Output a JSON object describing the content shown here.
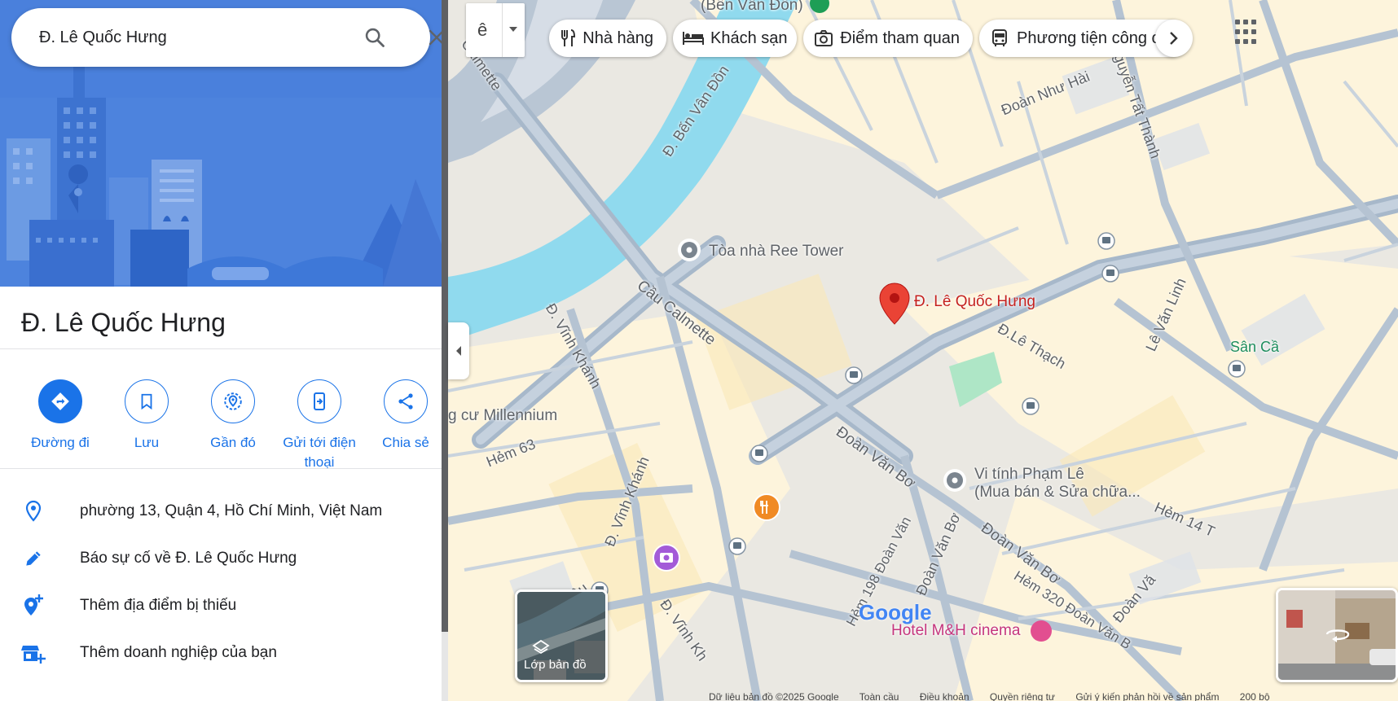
{
  "search": {
    "value": "Đ. Lê Quốc Hưng"
  },
  "place": {
    "title": "Đ. Lê Quốc Hưng"
  },
  "actions": [
    {
      "label": "Đường đi"
    },
    {
      "label": "Lưu"
    },
    {
      "label": "Gần đó"
    },
    {
      "label": "Gửi tới điện thoại"
    },
    {
      "label": "Chia sẻ"
    }
  ],
  "info": [
    {
      "text": "phường 13, Quận 4, Hồ Chí Minh, Việt Nam",
      "icon": "location-pin-icon"
    },
    {
      "text": "Báo sự cố về Đ. Lê Quốc Hưng",
      "icon": "pencil-icon"
    },
    {
      "text": "Thêm địa điểm bị thiếu",
      "icon": "add-place-icon"
    },
    {
      "text": "Thêm doanh nghiệp của bạn",
      "icon": "add-business-icon"
    }
  ],
  "toolbar": {
    "input_tool": "ê"
  },
  "chips": [
    {
      "label": "Nhà hàng",
      "icon": "fork-knife-icon"
    },
    {
      "label": "Khách sạn",
      "icon": "bed-icon"
    },
    {
      "label": "Điểm tham quan",
      "icon": "camera-icon"
    },
    {
      "label": "Phương tiện công c",
      "icon": "bus-icon"
    }
  ],
  "map": {
    "streets": {
      "ben_van_don_top": "(Bến Vân Đồn)",
      "calmette_top": "Calmette",
      "ben_van_don": "Đ. Bến Vân Đồn",
      "doan_nhu_hai": "Đoàn Như Hài",
      "nguyen_tat_thanh": "Nguyễn Tất Thành",
      "cau_calmette": "Cầu Calmette",
      "vinh_khanh_1": "Đ. Vĩnh Khánh",
      "vinh_khanh_2": "Đ. Vĩnh Khánh",
      "vinh_khanh_3": "Đ. Vĩnh Kh",
      "le_thach": "Đ.Lê Thạch",
      "le_van_linh": "Lê Văn Linh",
      "doan_van_bo_1": "Đoàn Văn Bơ",
      "doan_van_bo_2": "Đoàn Văn Bơ",
      "doan_van_bo_3": "Đoàn Văn Bơ",
      "doan_van_bo_4": "Đoàn Vă",
      "hem_63": "Hẻm 63",
      "hem_14": "Hẻm 14 T",
      "hem_198": "Hẻm 198 Đoàn Văn",
      "hem_320": "Hẻm 320 Đoàn Văn B",
      "hieu": "iệu",
      "san_ca": "Sân Cầ"
    },
    "pois": {
      "ree_tower": "Tòa nhà Ree Tower",
      "millennium": "g cư Millennium",
      "vi_tinh_1": "Vi tính Phạm Lê",
      "vi_tinh_2": "(Mua bán & Sửa chữa...",
      "hotel_mh": "Hotel M&H cinema"
    },
    "pin_label": "Đ. Lê Quốc Hưng",
    "layers_label": "Lớp bản đồ",
    "google_logo": "Google"
  },
  "footer": {
    "items": [
      "Dữ liệu bản đồ ©2025 Google",
      "Toàn cầu",
      "Điều khoản",
      "Quyền riêng tư",
      "Gửi ý kiến phản hồi về sản phẩm",
      "200 bộ"
    ]
  },
  "colors": {
    "accent": "#1a73e8",
    "water": "#90daee",
    "pin": "#ea4335",
    "road": "#aebdcc",
    "block": "#fdf4dd"
  }
}
